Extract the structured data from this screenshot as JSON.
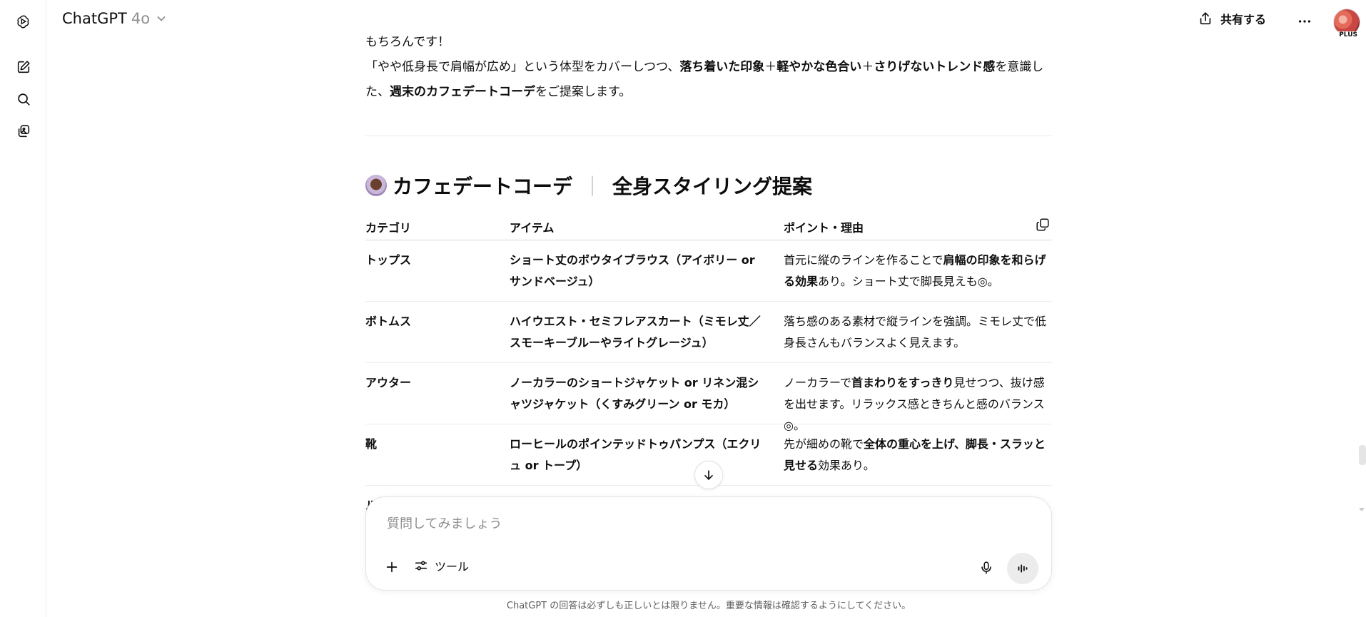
{
  "header": {
    "model_name": "ChatGPT",
    "model_version": "4o",
    "share_label": "共有する",
    "avatar_badge": "PLUS"
  },
  "rail": {
    "icons": [
      "openai-logo-icon",
      "new-chat-icon",
      "search-icon",
      "library-icon"
    ]
  },
  "message": {
    "line1": "もちろんです！",
    "line2_a": "「やや低身長で肩幅が広め」という体型をカバーしつつ、",
    "line2_b": "落ち着いた印象",
    "line2_c": "＋",
    "line2_d": "軽やかな色合い",
    "line2_e": "＋",
    "line2_f": "さりげないトレンド感",
    "line2_g": "を意識し",
    "line3_a": "た、",
    "line3_b": "週末のカフェデートコーデ",
    "line3_c": "をご提案します。"
  },
  "section": {
    "title_a": "カフェデートコーデ",
    "title_sep": "｜",
    "title_b": "全身スタイリング提案"
  },
  "table": {
    "headers": [
      "カテゴリ",
      "アイテム",
      "ポイント・理由"
    ],
    "rows": [
      {
        "category": "トップス",
        "item": "ショート丈のボウタイブラウス（アイボリー or サンドベージュ）",
        "reason_a": "首元に縦のラインを作ることで",
        "reason_b": "肩幅の印象を和らげる効果",
        "reason_c": "あり。ショート丈で脚長見えも◎。"
      },
      {
        "category": "ボトムス",
        "item": "ハイウエスト・セミフレアスカート（ミモレ丈／スモーキーブルーやライトグレージュ）",
        "reason_a": "落ち感のある素材で縦ラインを強調。ミモレ丈で低身長さんもバランスよく見えます。",
        "reason_b": "",
        "reason_c": ""
      },
      {
        "category": "アウター",
        "item": "ノーカラーのショートジャケット or リネン混シャツジャケット（くすみグリーン or モカ）",
        "reason_a": "ノーカラーで",
        "reason_b": "首まわりをすっきり",
        "reason_c": "見せつつ、抜け感を出せます。リラックス感ときちんと感のバランス◎。"
      },
      {
        "category": "靴",
        "item": "ローヒールのポインテッドトゥパンプス（エクリュ or トープ）",
        "reason_a": "先が細めの靴で",
        "reason_b": "全体の重心を上げ、脚長・スラッと見せる",
        "reason_c": "効果あり。"
      }
    ],
    "partial_row_glyph": "ルー"
  },
  "composer": {
    "placeholder": "質問してみましょう",
    "tools_label": "ツール"
  },
  "footer": {
    "disclaimer": "ChatGPT の回答は必ずしも正しいとは限りません。重要な情報は確認するようにしてください。"
  }
}
